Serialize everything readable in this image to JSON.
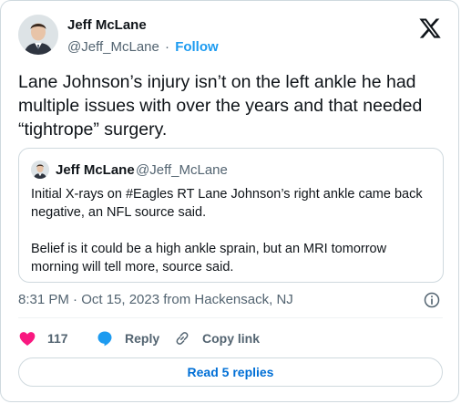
{
  "author": {
    "name": "Jeff McLane",
    "handle": "@Jeff_McLane",
    "separator": "·",
    "follow_label": "Follow"
  },
  "tweet": {
    "text": "Lane Johnson’s injury isn’t on the left ankle he had multiple issues with over the years and that needed “tightrope” surgery."
  },
  "quote": {
    "name": "Jeff McLane",
    "handle": "@Jeff_McLane",
    "paragraph1": "Initial X-rays on #Eagles RT Lane Johnson’s right ankle came back negative, an NFL source said.",
    "paragraph2": "Belief is it could be a high ankle sprain, but an MRI tomorrow morning will tell more, source said."
  },
  "meta": {
    "timestamp": "8:31 PM · Oct 15, 2023 from Hackensack, NJ"
  },
  "actions": {
    "like_count": "117",
    "reply_label": "Reply",
    "copy_link_label": "Copy link"
  },
  "footer": {
    "read_replies_label": "Read 5 replies"
  },
  "colors": {
    "accent": "#1d9bf0",
    "like": "#f91880",
    "secondary_text": "#536471",
    "border": "#cfd9de",
    "replies_link": "#006fd6"
  },
  "icons": {
    "logo": "x-logo-icon",
    "info": "info-icon",
    "like": "heart-icon",
    "reply": "speech-bubble-icon",
    "copy_link": "link-icon"
  }
}
